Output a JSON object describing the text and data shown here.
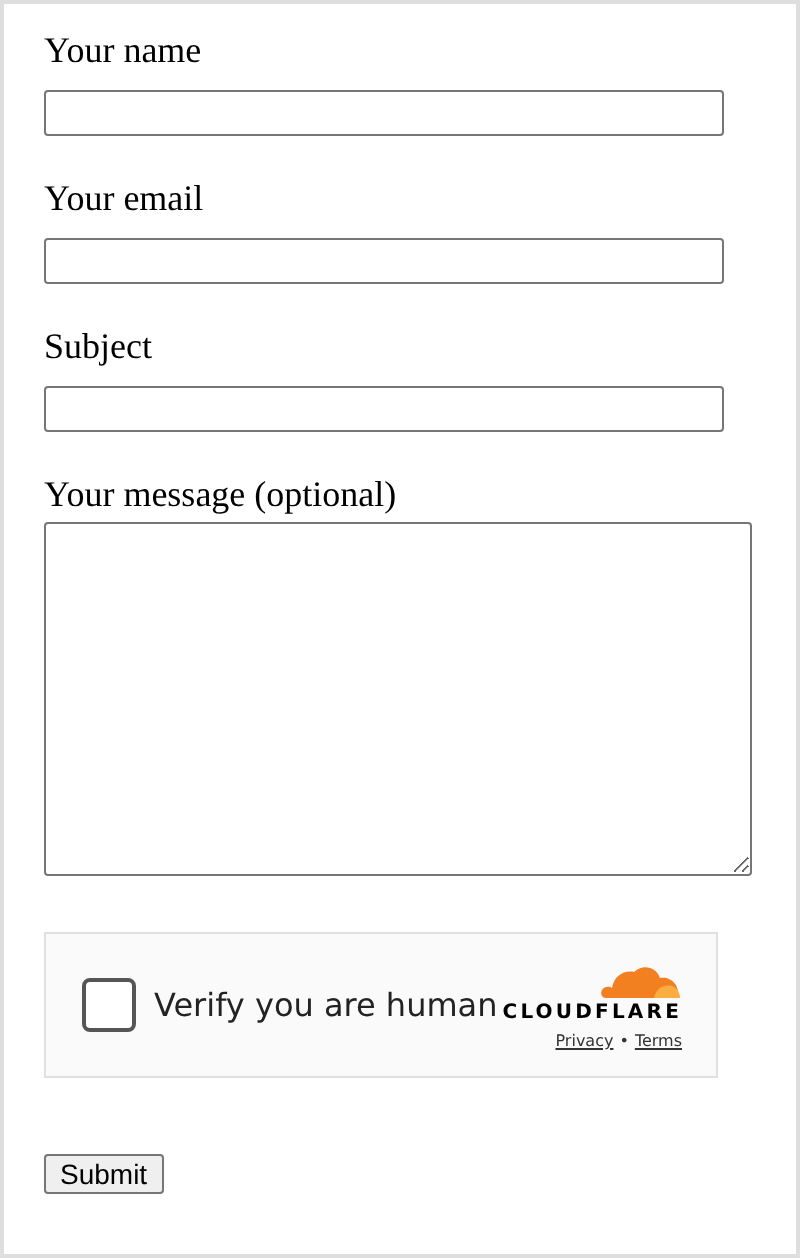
{
  "fields": [
    {
      "kind": "input",
      "label": "Your name"
    },
    {
      "kind": "input",
      "label": "Your email"
    },
    {
      "kind": "input",
      "label": "Subject"
    },
    {
      "kind": "textarea",
      "label": "Your message (optional)"
    }
  ],
  "captcha": {
    "checked": false,
    "label": "Verify you are human",
    "brand": "CLOUDFLARE",
    "links": [
      "Privacy",
      "Terms"
    ],
    "separator": "•"
  },
  "submit": "Submit"
}
